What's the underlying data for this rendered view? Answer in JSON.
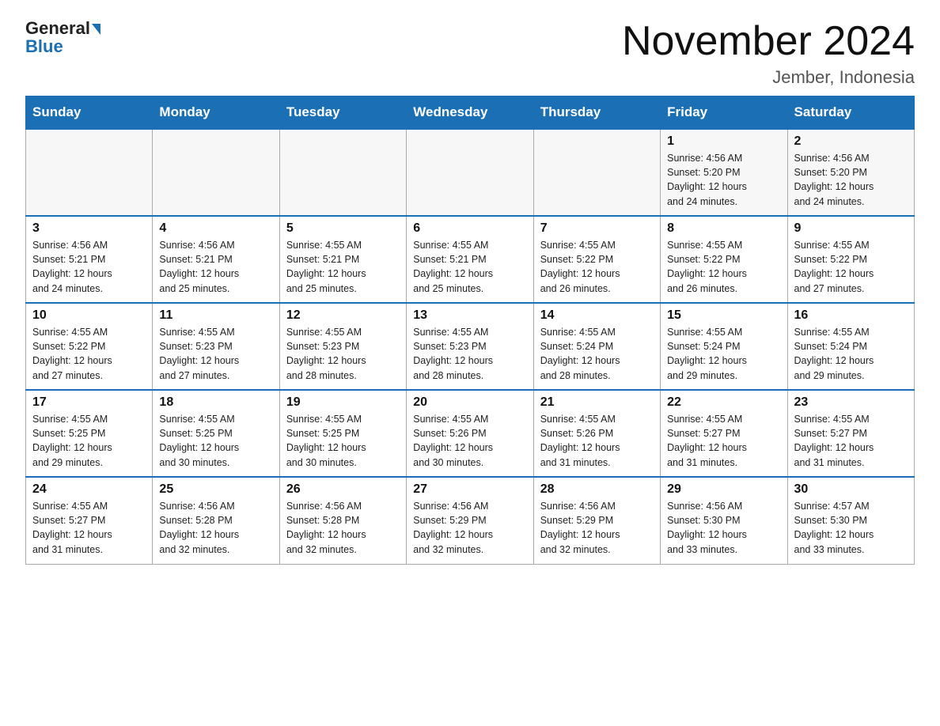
{
  "header": {
    "logo_line1": "General",
    "logo_line2": "Blue",
    "title": "November 2024",
    "subtitle": "Jember, Indonesia"
  },
  "days_of_week": [
    "Sunday",
    "Monday",
    "Tuesday",
    "Wednesday",
    "Thursday",
    "Friday",
    "Saturday"
  ],
  "weeks": [
    [
      {
        "day": "",
        "info": ""
      },
      {
        "day": "",
        "info": ""
      },
      {
        "day": "",
        "info": ""
      },
      {
        "day": "",
        "info": ""
      },
      {
        "day": "",
        "info": ""
      },
      {
        "day": "1",
        "info": "Sunrise: 4:56 AM\nSunset: 5:20 PM\nDaylight: 12 hours\nand 24 minutes."
      },
      {
        "day": "2",
        "info": "Sunrise: 4:56 AM\nSunset: 5:20 PM\nDaylight: 12 hours\nand 24 minutes."
      }
    ],
    [
      {
        "day": "3",
        "info": "Sunrise: 4:56 AM\nSunset: 5:21 PM\nDaylight: 12 hours\nand 24 minutes."
      },
      {
        "day": "4",
        "info": "Sunrise: 4:56 AM\nSunset: 5:21 PM\nDaylight: 12 hours\nand 25 minutes."
      },
      {
        "day": "5",
        "info": "Sunrise: 4:55 AM\nSunset: 5:21 PM\nDaylight: 12 hours\nand 25 minutes."
      },
      {
        "day": "6",
        "info": "Sunrise: 4:55 AM\nSunset: 5:21 PM\nDaylight: 12 hours\nand 25 minutes."
      },
      {
        "day": "7",
        "info": "Sunrise: 4:55 AM\nSunset: 5:22 PM\nDaylight: 12 hours\nand 26 minutes."
      },
      {
        "day": "8",
        "info": "Sunrise: 4:55 AM\nSunset: 5:22 PM\nDaylight: 12 hours\nand 26 minutes."
      },
      {
        "day": "9",
        "info": "Sunrise: 4:55 AM\nSunset: 5:22 PM\nDaylight: 12 hours\nand 27 minutes."
      }
    ],
    [
      {
        "day": "10",
        "info": "Sunrise: 4:55 AM\nSunset: 5:22 PM\nDaylight: 12 hours\nand 27 minutes."
      },
      {
        "day": "11",
        "info": "Sunrise: 4:55 AM\nSunset: 5:23 PM\nDaylight: 12 hours\nand 27 minutes."
      },
      {
        "day": "12",
        "info": "Sunrise: 4:55 AM\nSunset: 5:23 PM\nDaylight: 12 hours\nand 28 minutes."
      },
      {
        "day": "13",
        "info": "Sunrise: 4:55 AM\nSunset: 5:23 PM\nDaylight: 12 hours\nand 28 minutes."
      },
      {
        "day": "14",
        "info": "Sunrise: 4:55 AM\nSunset: 5:24 PM\nDaylight: 12 hours\nand 28 minutes."
      },
      {
        "day": "15",
        "info": "Sunrise: 4:55 AM\nSunset: 5:24 PM\nDaylight: 12 hours\nand 29 minutes."
      },
      {
        "day": "16",
        "info": "Sunrise: 4:55 AM\nSunset: 5:24 PM\nDaylight: 12 hours\nand 29 minutes."
      }
    ],
    [
      {
        "day": "17",
        "info": "Sunrise: 4:55 AM\nSunset: 5:25 PM\nDaylight: 12 hours\nand 29 minutes."
      },
      {
        "day": "18",
        "info": "Sunrise: 4:55 AM\nSunset: 5:25 PM\nDaylight: 12 hours\nand 30 minutes."
      },
      {
        "day": "19",
        "info": "Sunrise: 4:55 AM\nSunset: 5:25 PM\nDaylight: 12 hours\nand 30 minutes."
      },
      {
        "day": "20",
        "info": "Sunrise: 4:55 AM\nSunset: 5:26 PM\nDaylight: 12 hours\nand 30 minutes."
      },
      {
        "day": "21",
        "info": "Sunrise: 4:55 AM\nSunset: 5:26 PM\nDaylight: 12 hours\nand 31 minutes."
      },
      {
        "day": "22",
        "info": "Sunrise: 4:55 AM\nSunset: 5:27 PM\nDaylight: 12 hours\nand 31 minutes."
      },
      {
        "day": "23",
        "info": "Sunrise: 4:55 AM\nSunset: 5:27 PM\nDaylight: 12 hours\nand 31 minutes."
      }
    ],
    [
      {
        "day": "24",
        "info": "Sunrise: 4:55 AM\nSunset: 5:27 PM\nDaylight: 12 hours\nand 31 minutes."
      },
      {
        "day": "25",
        "info": "Sunrise: 4:56 AM\nSunset: 5:28 PM\nDaylight: 12 hours\nand 32 minutes."
      },
      {
        "day": "26",
        "info": "Sunrise: 4:56 AM\nSunset: 5:28 PM\nDaylight: 12 hours\nand 32 minutes."
      },
      {
        "day": "27",
        "info": "Sunrise: 4:56 AM\nSunset: 5:29 PM\nDaylight: 12 hours\nand 32 minutes."
      },
      {
        "day": "28",
        "info": "Sunrise: 4:56 AM\nSunset: 5:29 PM\nDaylight: 12 hours\nand 32 minutes."
      },
      {
        "day": "29",
        "info": "Sunrise: 4:56 AM\nSunset: 5:30 PM\nDaylight: 12 hours\nand 33 minutes."
      },
      {
        "day": "30",
        "info": "Sunrise: 4:57 AM\nSunset: 5:30 PM\nDaylight: 12 hours\nand 33 minutes."
      }
    ]
  ]
}
